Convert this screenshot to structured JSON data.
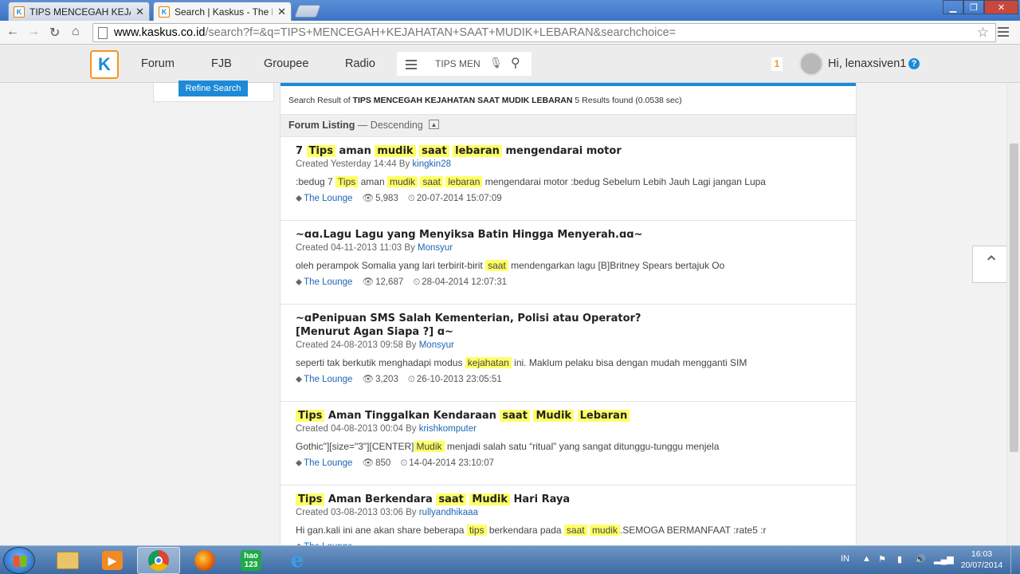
{
  "browser": {
    "tabs": [
      {
        "title": "TIPS MENCEGAH KEJAHATAN SAAT MUDIK",
        "active": false
      },
      {
        "title": "Search | Kaskus - The Largest",
        "active": true
      }
    ],
    "close_glyph": "✕",
    "url_host": "www.kaskus.co.id",
    "url_path": "/search?f=&q=TIPS+MENCEGAH+KEJAHATAN+SAAT+MUDIK+LEBARAN&searchchoice="
  },
  "site_header": {
    "logo_text": "K",
    "nav": [
      "Forum",
      "FJB",
      "Groupee",
      "Radio"
    ],
    "search_value": "TIPS MENCEGAH KEJAHATAN SAAT MUDIK LEBARAN",
    "notification_count": "1",
    "greeting": "Hi, lenaxsiven1",
    "help_glyph": "?"
  },
  "sidebar": {
    "refine_label": "Refine Search"
  },
  "results_summary": {
    "prefix": "Search Result of",
    "query": "TIPS MENCEGAH KEJAHATAN SAAT MUDIK LEBARAN",
    "count_text": "5 Results found (0.0538 sec)"
  },
  "listing": {
    "label": "Forum Listing",
    "sort": "— Descending"
  },
  "results": [
    {
      "title": [
        {
          "t": "7 "
        },
        {
          "t": "Tips",
          "hl": true
        },
        {
          "t": " aman "
        },
        {
          "t": "mudik",
          "hl": true
        },
        {
          "t": " "
        },
        {
          "t": "saat",
          "hl": true
        },
        {
          "t": " "
        },
        {
          "t": "lebaran",
          "hl": true
        },
        {
          "t": " mengendarai motor"
        }
      ],
      "created": "Created Yesterday 14:44 By",
      "author": "kingkin28",
      "snippet": [
        {
          "t": ":bedug 7 "
        },
        {
          "t": "Tips",
          "hl": true
        },
        {
          "t": " aman "
        },
        {
          "t": "mudik",
          "hl": true
        },
        {
          "t": " "
        },
        {
          "t": "saat",
          "hl": true
        },
        {
          "t": " "
        },
        {
          "t": "lebaran",
          "hl": true
        },
        {
          "t": " mengendarai motor :bedug Sebelum Lebih Jauh Lagi jangan Lupa"
        }
      ],
      "category": "The Lounge",
      "views": "5,983",
      "last_post": "20-07-2014 15:07:09"
    },
    {
      "title": [
        {
          "t": "~ɑɑ.Lagu Lagu yang Menyiksa Batin Hingga Menyerah.ɑɑ~"
        }
      ],
      "created": "Created 04-11-2013 11:03 By",
      "author": "Monsyur",
      "snippet": [
        {
          "t": "oleh perampok Somalia yang lari terbirit-birit "
        },
        {
          "t": "saat",
          "hl": true
        },
        {
          "t": " mendengarkan lagu [B]Britney Spears bertajuk Oo"
        }
      ],
      "category": "The Lounge",
      "views": "12,687",
      "last_post": "28-04-2014 12:07:31"
    },
    {
      "title": [
        {
          "t": "~ɑPenipuan SMS Salah Kementerian, Polisi atau Operator?"
        }
      ],
      "title2": "[Menurut Agan Siapa ?] ɑ~",
      "created": "Created 24-08-2013 09:58 By",
      "author": "Monsyur",
      "snippet": [
        {
          "t": "seperti tak berkutik menghadapi modus "
        },
        {
          "t": "kejahatan",
          "hl": true
        },
        {
          "t": " ini. Maklum pelaku bisa dengan mudah mengganti SIM"
        }
      ],
      "category": "The Lounge",
      "views": "3,203",
      "last_post": "26-10-2013 23:05:51"
    },
    {
      "title": [
        {
          "t": "Tips",
          "hl": true
        },
        {
          "t": " Aman Tinggalkan Kendaraan "
        },
        {
          "t": "saat",
          "hl": true
        },
        {
          "t": " "
        },
        {
          "t": "Mudik",
          "hl": true
        },
        {
          "t": " "
        },
        {
          "t": "Lebaran",
          "hl": true
        }
      ],
      "created": "Created 04-08-2013 00:04 By",
      "author": "krishkomputer",
      "snippet": [
        {
          "t": "Gothic\"][size=\"3\"][CENTER]"
        },
        {
          "t": "Mudik",
          "hl": true
        },
        {
          "t": " menjadi salah satu “ritual” yang sangat ditunggu-tunggu menjela"
        }
      ],
      "category": "The Lounge",
      "views": "850",
      "last_post": "14-04-2014 23:10:07"
    },
    {
      "title": [
        {
          "t": "Tips",
          "hl": true
        },
        {
          "t": " Aman Berkendara "
        },
        {
          "t": "saat",
          "hl": true
        },
        {
          "t": " "
        },
        {
          "t": "Mudik",
          "hl": true
        },
        {
          "t": " Hari Raya"
        }
      ],
      "created": "Created 03-08-2013 03:06 By",
      "author": "rullyandhikaaa",
      "snippet": [
        {
          "t": "Hi gan.kali ini ane akan share beberapa "
        },
        {
          "t": "tips",
          "hl": true
        },
        {
          "t": " berkendara pada "
        },
        {
          "t": "saat",
          "hl": true
        },
        {
          "t": " "
        },
        {
          "t": "mudik",
          "hl": true
        },
        {
          "t": ".SEMOGA BERMANFAAT :rate5 :r"
        }
      ],
      "category": "The Lounge",
      "views": "",
      "last_post": ""
    }
  ],
  "taskbar": {
    "language": "IN",
    "time": "16:03",
    "date": "20/07/2014",
    "hao_label": "hao\n123"
  },
  "colors": {
    "accent": "#1d8ad8",
    "highlight": "#ffff66",
    "brand_orange": "#f6941e"
  }
}
